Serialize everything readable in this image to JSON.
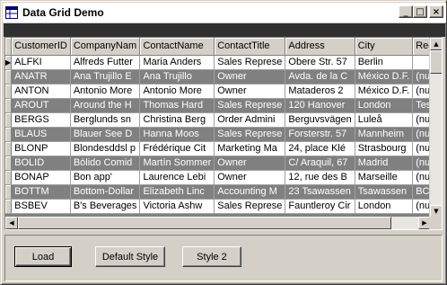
{
  "window": {
    "title": "Data Grid Demo",
    "app_icon": "grid-app-icon",
    "controls": {
      "minimize": "_",
      "maximize": "□",
      "close": "×"
    }
  },
  "grid": {
    "columns": [
      "CustomerID",
      "CompanyNam",
      "ContactName",
      "ContactTitle",
      "Address",
      "City",
      "Region"
    ],
    "current_row_marker": "▶",
    "rows": [
      [
        "ALFKI",
        "Alfreds Futter",
        "Maria Anders",
        "Sales Represe",
        "Obere Str. 57",
        "Berlin",
        ""
      ],
      [
        "ANATR",
        "Ana Trujillo E",
        "Ana Trujillo",
        "Owner",
        "Avda. de la C",
        "México D.F.",
        "(null)"
      ],
      [
        "ANTON",
        "Antonio More",
        "Antonio More",
        "Owner",
        "Mataderos  2",
        "México D.F.",
        "(null)"
      ],
      [
        "AROUT",
        "Around the H",
        "Thomas Hard",
        "Sales Represe",
        "120 Hanover",
        "London",
        "Test"
      ],
      [
        "BERGS",
        "Berglunds sn",
        "Christina Berg",
        "Order Admini",
        "Berguvsvägen",
        "Luleå",
        "(null)"
      ],
      [
        "BLAUS",
        "Blauer See D",
        "Hanna Moos",
        "Sales Represe",
        "Forsterstr. 57",
        "Mannheim",
        "(null)"
      ],
      [
        "BLONP",
        "Blondesddsl p",
        "Frédérique Cit",
        "Marketing Ma",
        "24, place Klé",
        "Strasbourg",
        "(null)"
      ],
      [
        "BOLID",
        "Bólido Comid",
        "Martín Sommer",
        "Owner",
        "C/ Araquil, 67",
        "Madrid",
        "(null)"
      ],
      [
        "BONAP",
        "Bon app'",
        "Laurence Lebi",
        "Owner",
        "12, rue des B",
        "Marseille",
        "(null)"
      ],
      [
        "BOTTM",
        "Bottom-Dollar",
        "Elizabeth Linc",
        "Accounting M",
        "23 Tsawassen",
        "Tsawassen",
        "BC"
      ],
      [
        "BSBEV",
        "B's Beverages",
        "Victoria Ashw",
        "Sales Represe",
        "Fauntleroy Cir",
        "London",
        "(null)"
      ]
    ]
  },
  "buttons": {
    "load": "Load",
    "default_style": "Default Style",
    "style2": "Style 2"
  },
  "colors": {
    "alt_row": "#808080",
    "row": "#ffffff",
    "chrome": "#d4d0c8"
  }
}
